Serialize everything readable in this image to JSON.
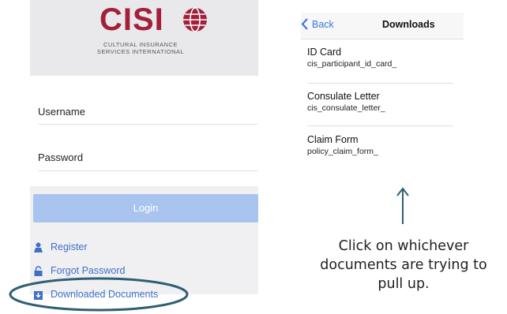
{
  "login": {
    "logo_text": "CISI",
    "logo_subtitle_line1": "CULTURAL INSURANCE",
    "logo_subtitle_line2": "SERVICES INTERNATIONAL",
    "username_label": "Username",
    "password_label": "Password",
    "login_button": "Login",
    "links": [
      {
        "label": "Register",
        "icon": "person-icon"
      },
      {
        "label": "Forgot Password",
        "icon": "lock-icon"
      },
      {
        "label": "Downloaded Documents",
        "icon": "download-box-icon"
      }
    ],
    "colors": {
      "brand": "#a3203a",
      "button": "#a9c4ef",
      "link": "#3f70c6",
      "highlight": "#2f5f74"
    }
  },
  "downloads": {
    "back_label": "Back",
    "title": "Downloads",
    "items": [
      {
        "title": "ID Card",
        "file": "cis_participant_id_card_"
      },
      {
        "title": "Consulate Letter",
        "file": "cis_consulate_letter_"
      },
      {
        "title": "Claim Form",
        "file": "policy_claim_form_"
      }
    ]
  },
  "annotation": {
    "caption_line1": "Click on whichever",
    "caption_line2": "documents are trying to",
    "caption_line3": "pull up."
  }
}
